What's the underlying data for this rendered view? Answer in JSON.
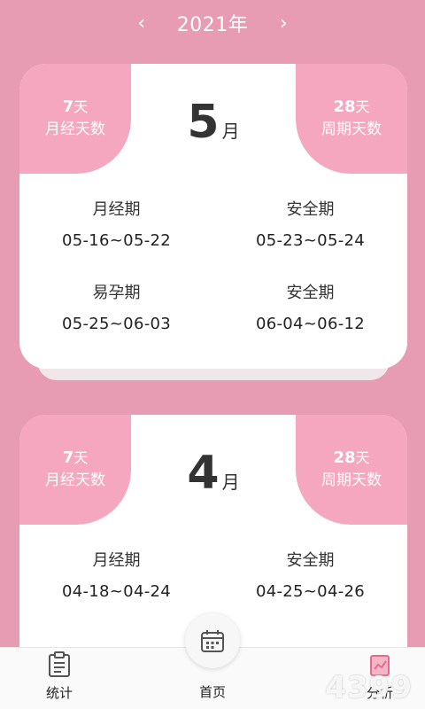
{
  "header": {
    "prev_icon": "‹",
    "year": "2021年",
    "next_icon": "›"
  },
  "cards": [
    {
      "period_days": "7",
      "period_days_unit": "天",
      "period_days_label": "月经天数",
      "cycle_days": "28",
      "cycle_days_unit": "天",
      "cycle_days_label": "周期天数",
      "month_num": "5",
      "month_unit": "月",
      "periods": [
        {
          "name": "月经期",
          "dates": "05-16~05-22"
        },
        {
          "name": "安全期",
          "dates": "05-23~05-24"
        },
        {
          "name": "易孕期",
          "dates": "05-25~06-03"
        },
        {
          "name": "安全期",
          "dates": "06-04~06-12"
        }
      ]
    },
    {
      "period_days": "7",
      "period_days_unit": "天",
      "period_days_label": "月经天数",
      "cycle_days": "28",
      "cycle_days_unit": "天",
      "cycle_days_label": "周期天数",
      "month_num": "4",
      "month_unit": "月",
      "periods": [
        {
          "name": "月经期",
          "dates": "04-18~04-24"
        },
        {
          "name": "安全期",
          "dates": "04-25~04-26"
        }
      ]
    }
  ],
  "nav": {
    "stats": "统计",
    "home": "首页",
    "analysis": "分析"
  },
  "watermark": "4399",
  "colors": {
    "background": "#e79cb3",
    "accent": "#f4a7bf"
  }
}
